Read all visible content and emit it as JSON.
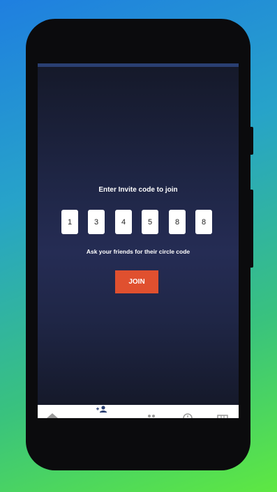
{
  "screen": {
    "title": "Enter Invite code to join",
    "hint": "Ask your friends for their circle code",
    "join_label": "JOIN"
  },
  "invite_code": [
    "1",
    "3",
    "4",
    "5",
    "8",
    "8"
  ],
  "nav": {
    "items": [
      {
        "icon": "home-icon"
      },
      {
        "icon": "add-person-icon",
        "active": true
      },
      {
        "icon": "people-icon"
      },
      {
        "icon": "location-icon"
      },
      {
        "icon": "map-icon"
      }
    ]
  },
  "colors": {
    "accent": "#e0502f",
    "nav_active": "#2a3f72",
    "background_top": "#1f7fe0",
    "background_bottom": "#5ee842"
  }
}
